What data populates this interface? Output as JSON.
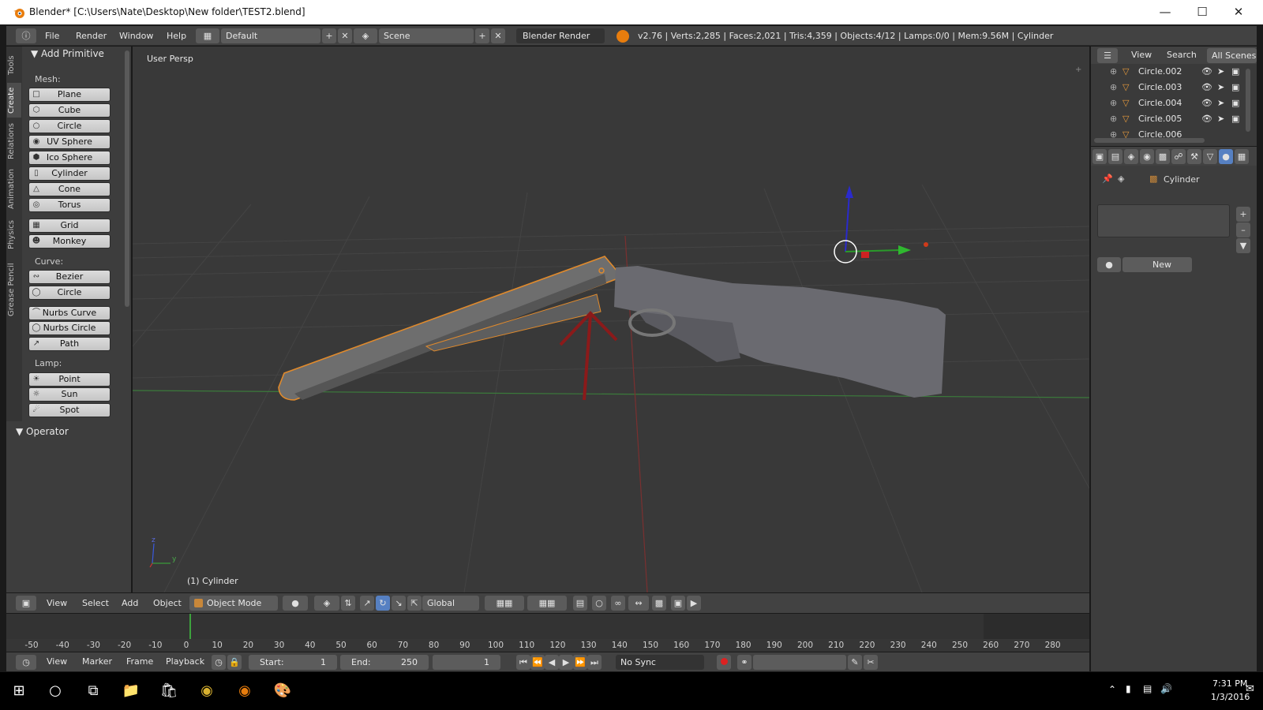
{
  "window": {
    "title": "Blender* [C:\\Users\\Nate\\Desktop\\New folder\\TEST2.blend]"
  },
  "top_menu": {
    "items": [
      "File",
      "Render",
      "Window",
      "Help"
    ]
  },
  "layout": {
    "value": "Default"
  },
  "scene": {
    "value": "Scene"
  },
  "engine": {
    "value": "Blender Render"
  },
  "stats": "v2.76 | Verts:2,285 | Faces:2,021 | Tris:4,359 | Objects:4/12 | Lamps:0/0 | Mem:9.56M | Cylinder",
  "tool_tabs": [
    "Tools",
    "Create",
    "Relations",
    "Animation",
    "Physics",
    "Grease Pencil"
  ],
  "add_primitive": {
    "title": "Add Primitive",
    "mesh_label": "Mesh:",
    "mesh": [
      "Plane",
      "Cube",
      "Circle",
      "UV Sphere",
      "Ico Sphere",
      "Cylinder",
      "Cone",
      "Torus",
      "Grid",
      "Monkey"
    ],
    "curve_label": "Curve:",
    "curve": [
      "Bezier",
      "Circle",
      "Nurbs Curve",
      "Nurbs Circle",
      "Path"
    ],
    "lamp_label": "Lamp:",
    "lamp": [
      "Point",
      "Sun",
      "Spot"
    ]
  },
  "operator": {
    "title": "Operator"
  },
  "viewport": {
    "view_label": "User Persp",
    "object_label": "(1) Cylinder"
  },
  "view_header": {
    "menus": [
      "View",
      "Select",
      "Add",
      "Object"
    ],
    "mode": "Object Mode",
    "orientation": "Global"
  },
  "timeline": {
    "ticks": [
      "-50",
      "-40",
      "-30",
      "-20",
      "-10",
      "0",
      "10",
      "20",
      "30",
      "40",
      "50",
      "60",
      "70",
      "80",
      "90",
      "100",
      "110",
      "120",
      "130",
      "140",
      "150",
      "160",
      "170",
      "180",
      "190",
      "200",
      "210",
      "220",
      "230",
      "240",
      "250",
      "260",
      "270",
      "280"
    ],
    "current_frame": 1
  },
  "timeline_header": {
    "menus": [
      "View",
      "Marker",
      "Frame",
      "Playback"
    ],
    "start_label": "Start:",
    "start": "1",
    "end_label": "End:",
    "end": "250",
    "frame": "1",
    "sync": "No Sync"
  },
  "outliner": {
    "menus": [
      "View",
      "Search"
    ],
    "filter": "All Scenes",
    "items": [
      "Circle.002",
      "Circle.003",
      "Circle.004",
      "Circle.005",
      "Circle.006"
    ]
  },
  "properties": {
    "context_object": "Cylinder",
    "new_button": "New"
  },
  "taskbar": {
    "time": "7:31 PM",
    "date": "1/3/2016"
  },
  "colors": {
    "selection_outline": "#e08a2c",
    "annotation_arrow": "#8b1a1a",
    "x_axis": "#b02a2a",
    "y_axis": "#2a8a2a"
  }
}
